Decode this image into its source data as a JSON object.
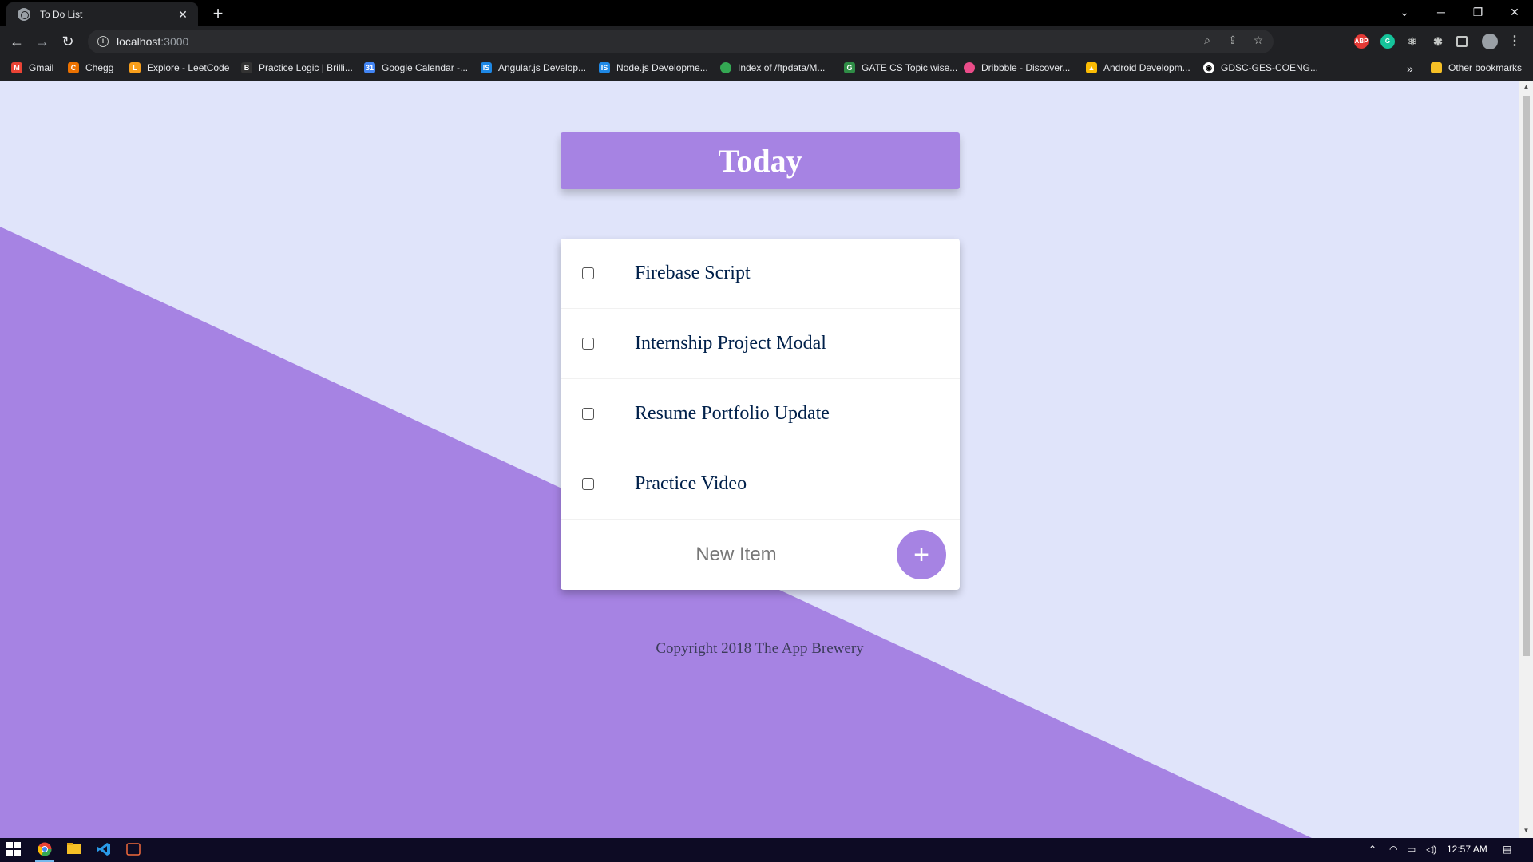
{
  "browser": {
    "tab_title": "To Do List",
    "tab_close": "✕",
    "new_tab": "+",
    "url_host": "localhost",
    "url_rest": ":3000",
    "window_controls": {
      "chevron": "⌄",
      "minimize": "─",
      "restore": "❐",
      "close": "✕"
    },
    "nav": {
      "back": "←",
      "forward": "→",
      "reload": "↻"
    },
    "omnibox_icons": {
      "zoom": "⌕",
      "share": "⇪",
      "star": "☆"
    },
    "extensions": [
      "ABP",
      "Grammarly",
      "React"
    ],
    "bookmarks": [
      {
        "label": "Gmail",
        "icon": "gmail-icon",
        "color": "#ea4335"
      },
      {
        "label": "Chegg",
        "icon": "chegg-icon",
        "color": "#eb7100"
      },
      {
        "label": "Explore - LeetCode",
        "icon": "leetcode-icon",
        "color": "#f89f1b"
      },
      {
        "label": "Practice Logic | Brilli...",
        "icon": "brilliant-icon",
        "color": "#333333"
      },
      {
        "label": "Google Calendar -...",
        "icon": "calendar-icon",
        "color": "#4285f4"
      },
      {
        "label": "Angular.js Develop...",
        "icon": "is-icon",
        "color": "#1e88e5"
      },
      {
        "label": "Node.js Developme...",
        "icon": "is-icon",
        "color": "#1e88e5"
      },
      {
        "label": "Index of /ftpdata/M...",
        "icon": "globe-icon",
        "color": "#34a853"
      },
      {
        "label": "GATE CS Topic wise...",
        "icon": "gfg-icon",
        "color": "#2f8d46"
      },
      {
        "label": "Dribbble - Discover...",
        "icon": "dribbble-icon",
        "color": "#ea4c89"
      },
      {
        "label": "Android Developm...",
        "icon": "drive-icon",
        "color": "#fbbc04"
      },
      {
        "label": "GDSC-GES-COENG...",
        "icon": "github-icon",
        "color": "#ffffff"
      }
    ],
    "more_bookmarks": "»",
    "other_bookmarks": "Other bookmarks"
  },
  "app": {
    "heading": "Today",
    "items": [
      {
        "text": "Firebase Script",
        "checked": false
      },
      {
        "text": "Internship Project Modal",
        "checked": false
      },
      {
        "text": "Resume Portfolio Update",
        "checked": false
      },
      {
        "text": "Practice Video",
        "checked": false
      }
    ],
    "new_item_placeholder": "New Item",
    "add_button": "+",
    "footer": "Copyright 2018 The App Brewery"
  },
  "taskbar": {
    "clock": "12:57 AM",
    "apps": [
      "windows-start",
      "chrome",
      "file-explorer",
      "vscode",
      "terminal"
    ]
  },
  "colors": {
    "accent": "#a683e3",
    "page_bg": "#e0e4fa",
    "item_text": "#00204a"
  }
}
